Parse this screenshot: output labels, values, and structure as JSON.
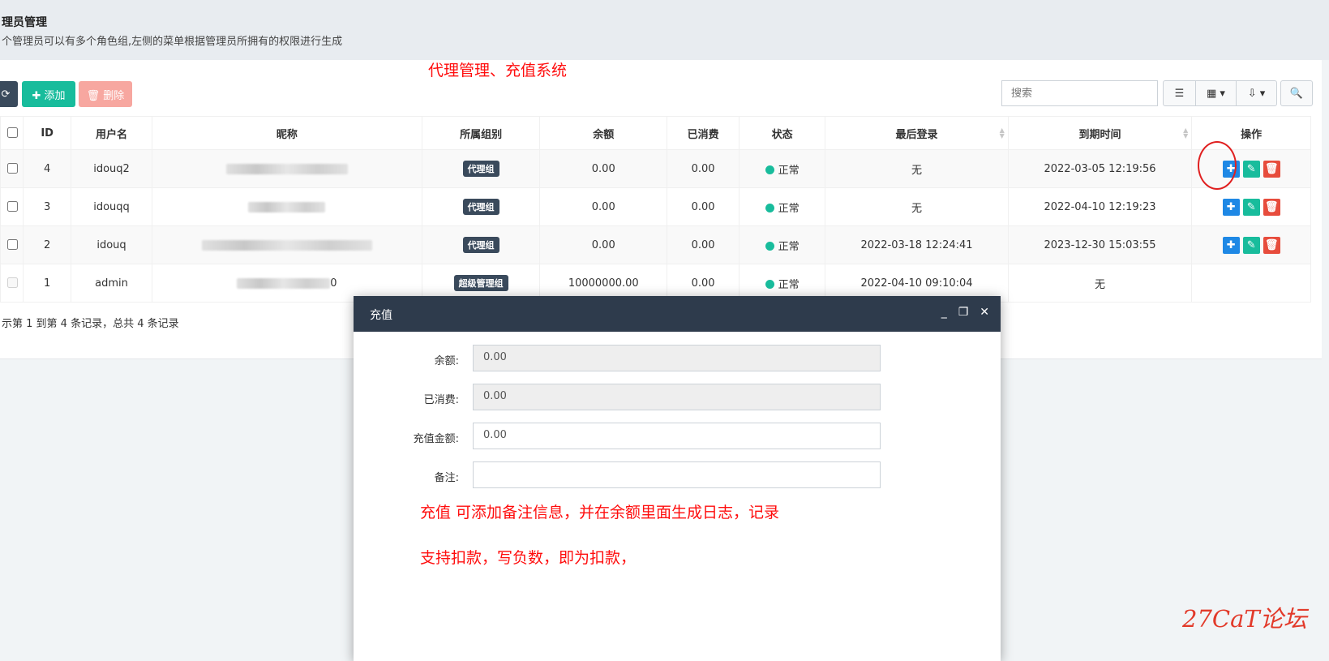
{
  "header": {
    "title": "理员管理",
    "description": "个管理员可以有多个角色组,左侧的菜单根据管理员所拥有的权限进行生成"
  },
  "annotations": {
    "top_note": "代理管理、充值系统",
    "modal_note_1": "充值 可添加备注信息，并在余额里面生成日志，记录",
    "modal_note_2": "支持扣款，写负数，即为扣款，",
    "watermark": "27CaT论坛"
  },
  "toolbar": {
    "refresh_icon": "refresh-icon",
    "add_label": "✚ 添加",
    "delete_label": "🗑 删除",
    "search_placeholder": "搜索"
  },
  "table": {
    "headers": [
      "ID",
      "用户名",
      "昵称",
      "所属组别",
      "余额",
      "已消费",
      "状态",
      "最后登录",
      "到期时间",
      "操作"
    ],
    "rows": [
      {
        "id": "4",
        "username": "idouq2",
        "group": "代理组",
        "balance": "0.00",
        "spent": "0.00",
        "status": "正常",
        "last_login": "无",
        "expire": "2022-03-05 12:19:56"
      },
      {
        "id": "3",
        "username": "idouqq",
        "group": "代理组",
        "balance": "0.00",
        "spent": "0.00",
        "status": "正常",
        "last_login": "无",
        "expire": "2022-04-10 12:19:23"
      },
      {
        "id": "2",
        "username": "idouq",
        "group": "代理组",
        "balance": "0.00",
        "spent": "0.00",
        "status": "正常",
        "last_login": "2022-03-18 12:24:41",
        "expire": "2023-12-30 15:03:55"
      },
      {
        "id": "1",
        "username": "admin",
        "nickname_tail": "0",
        "group": "超级管理组",
        "balance": "10000000.00",
        "spent": "0.00",
        "status": "正常",
        "last_login": "2022-04-10 09:10:04",
        "expire": "无"
      }
    ]
  },
  "pager": {
    "summary": "示第 1 到第 4 条记录，总共 4 条记录"
  },
  "modal": {
    "title": "充值",
    "fields": [
      {
        "label": "余额:",
        "value": "0.00"
      },
      {
        "label": "已消费:",
        "value": "0.00"
      },
      {
        "label": "充值金额:",
        "value": "0.00"
      },
      {
        "label": "备注:",
        "value": ""
      }
    ]
  }
}
